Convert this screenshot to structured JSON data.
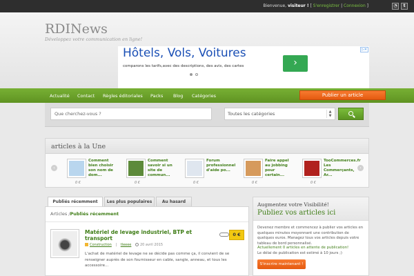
{
  "topbar": {
    "welcome_prefix": "Bienvenue, ",
    "visitor": "visiteur !",
    "register": "S'enregistrer",
    "login": "Connexion",
    "rss_icon": "rss-icon",
    "twitter_icon": "twitter-icon"
  },
  "header": {
    "logo": "RDINews",
    "tagline": "Développez votre communication en ligne!"
  },
  "ad": {
    "headline": "Hôtels, Vols, Voitures",
    "subline": "comparons les tarifs,avec des descriptions, des avis, des cartes",
    "go_icon": "chevron-right-icon"
  },
  "nav": {
    "items": [
      "Actualité",
      "Contact",
      "Règles éditoriales",
      "Packs",
      "Blog",
      "Catégories"
    ],
    "publish": "Publier un article"
  },
  "search": {
    "placeholder": "Que cherchez-vous ?",
    "category": "Toutes les catégories"
  },
  "une": {
    "title": "articles à la Une",
    "items": [
      {
        "title": "Comment bien choisir son nom de dom...",
        "price": "0 €",
        "color": "#b9d6ee"
      },
      {
        "title": "Comment savoir si un site de commun...",
        "price": "0 €",
        "color": "#5d8a3a"
      },
      {
        "title": "Forum professionnel d'aide po...",
        "price": "0 €",
        "color": "#dfe6ef"
      },
      {
        "title": "Faire appel au jobbing pour certain...",
        "price": "0 €",
        "color": "#d69a5c"
      },
      {
        "title": "TooCommerces.fr Les Commerçants, Ar...",
        "price": "0 €",
        "color": "#b1221e"
      }
    ]
  },
  "tabs": [
    "Publiés récemment",
    "Les plus populaires",
    "Au hasard"
  ],
  "breadcrumb": {
    "root": "Articles",
    "sep": " /",
    "current": "Publiés récemment"
  },
  "article": {
    "title": "Matériel de levage industriel, BTP et transport",
    "category": "Construction",
    "author": "tleeee",
    "date": "20 avril 2015",
    "body": "L'achat de matériel de levage ne se décide pas comme ça, il convient de se renseigner auprès de son fournisseur en cable, sangle, anneau, et tous les accessoire...",
    "price": "0 €"
  },
  "side": {
    "heading": "Augmentez votre Visibilité!",
    "subheading": "Publiez vos articles ici",
    "text": "Devenez membre et commencez à publier vos articles en quelques minutes moyennant une contribution de quelques euros. Managez tous vos articles depuis votre tableau de bord personnalisé.",
    "current": "Actuellement 0 articles en attente de publication!",
    "delay": "Le délai de publication est estimé à 10 jours ;)",
    "cta": "S'inscrire maintenant !"
  }
}
